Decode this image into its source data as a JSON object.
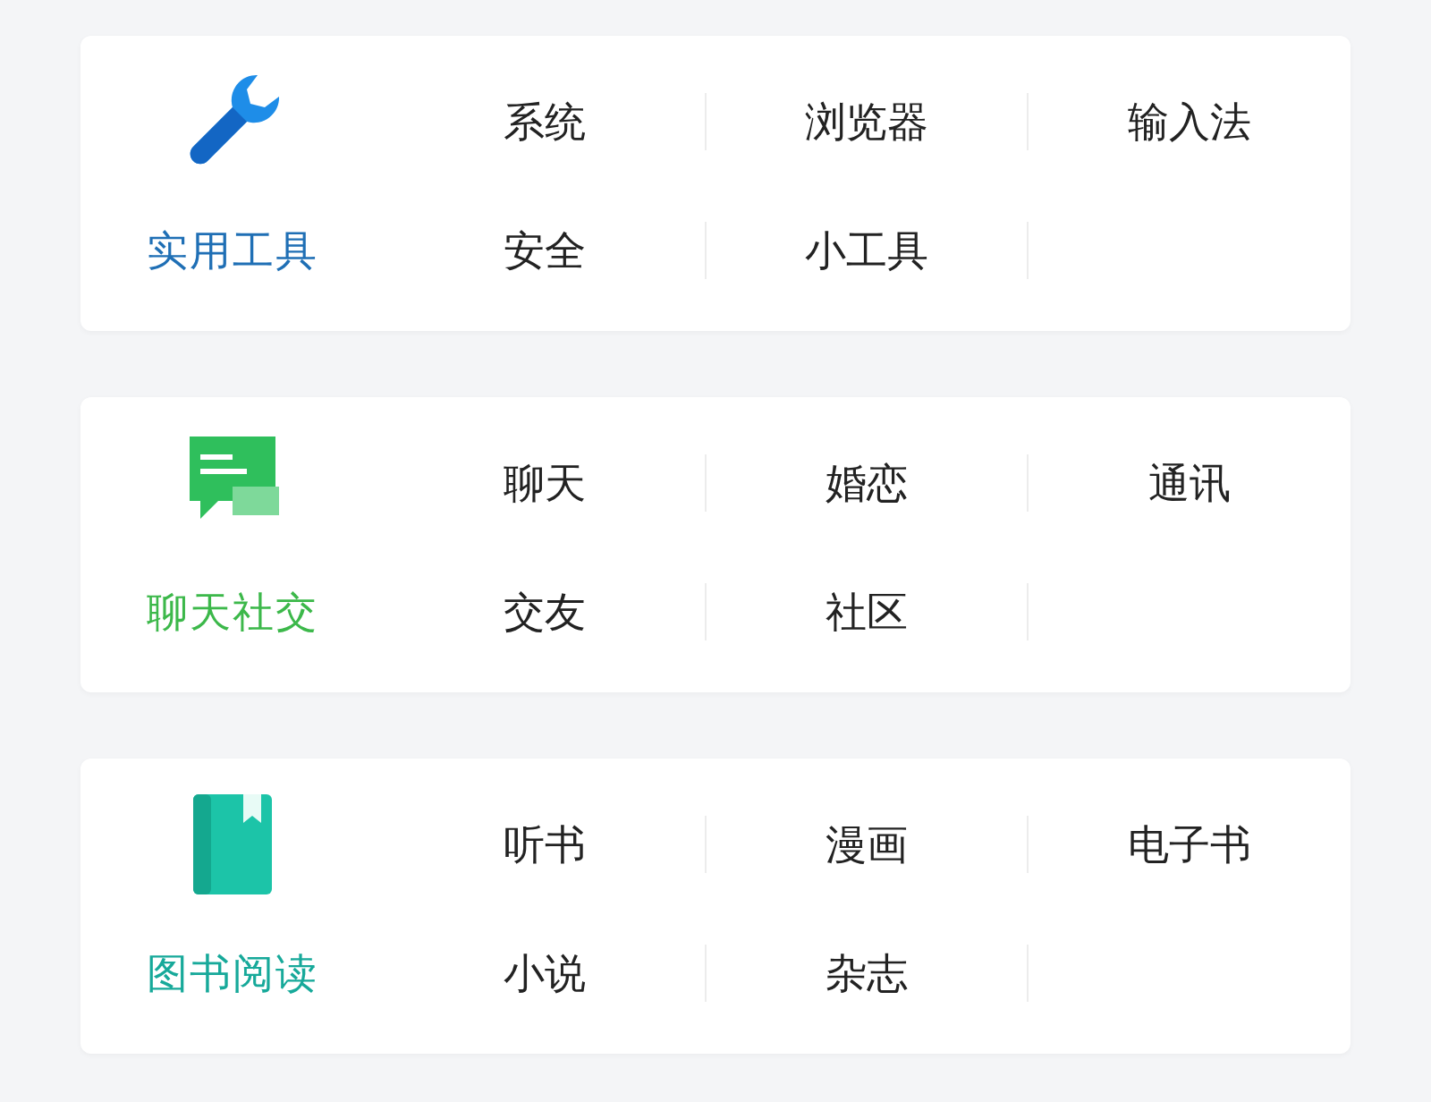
{
  "categories": [
    {
      "name": "实用工具",
      "color": "#1f6fb5",
      "kind": "tools",
      "items": [
        "系统",
        "浏览器",
        "输入法",
        "安全",
        "小工具"
      ]
    },
    {
      "name": "聊天社交",
      "color": "#3cb84a",
      "kind": "social",
      "items": [
        "聊天",
        "婚恋",
        "通讯",
        "交友",
        "社区"
      ]
    },
    {
      "name": "图书阅读",
      "color": "#17a99a",
      "kind": "reading",
      "items": [
        "听书",
        "漫画",
        "电子书",
        "小说",
        "杂志"
      ]
    }
  ]
}
